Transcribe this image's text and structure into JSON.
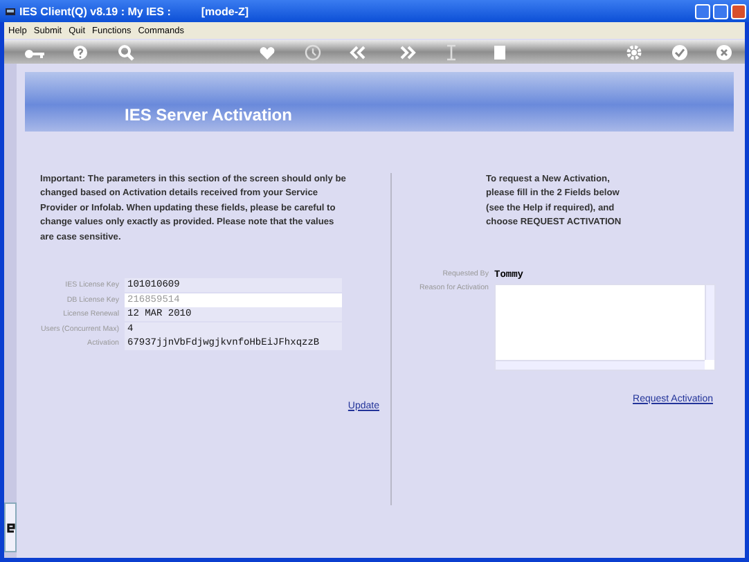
{
  "window": {
    "title": "IES Client(Q) v8.19 : My IES :",
    "mode": "[mode-Z]"
  },
  "menu": [
    "Help",
    "Submit",
    "Quit",
    "Functions",
    "Commands"
  ],
  "banner": {
    "title": "IES Server Activation"
  },
  "left": {
    "notice": "Important: The parameters in this section of the screen should only be changed based on Activation details received from your Service Provider or Infolab. When updating  these fields, please be careful to change values only exactly as  provided. Please note that the values are case sensitive.",
    "fields": [
      {
        "label": "IES License Key",
        "value": "101010609",
        "focused": false
      },
      {
        "label": "DB License Key",
        "value": "216859514",
        "focused": true
      },
      {
        "label": "License Renewal",
        "value": "12 MAR 2010",
        "focused": false
      },
      {
        "label": "Users (Concurrent Max)",
        "value": "4",
        "focused": false
      },
      {
        "label": "Activation",
        "value": "67937jjnVbFdjwgjkvnfoHbEiJFhxqzzB",
        "focused": false
      }
    ],
    "link": "Update"
  },
  "right": {
    "notice": "To request a New Activation, please fill in the 2 Fields below (see the Help if required), and choose REQUEST ACTIVATION",
    "requested_by": {
      "label": "Requested By",
      "value": "Tommy"
    },
    "reason": {
      "label": "Reason for Activation"
    },
    "link": "Request Activation"
  }
}
